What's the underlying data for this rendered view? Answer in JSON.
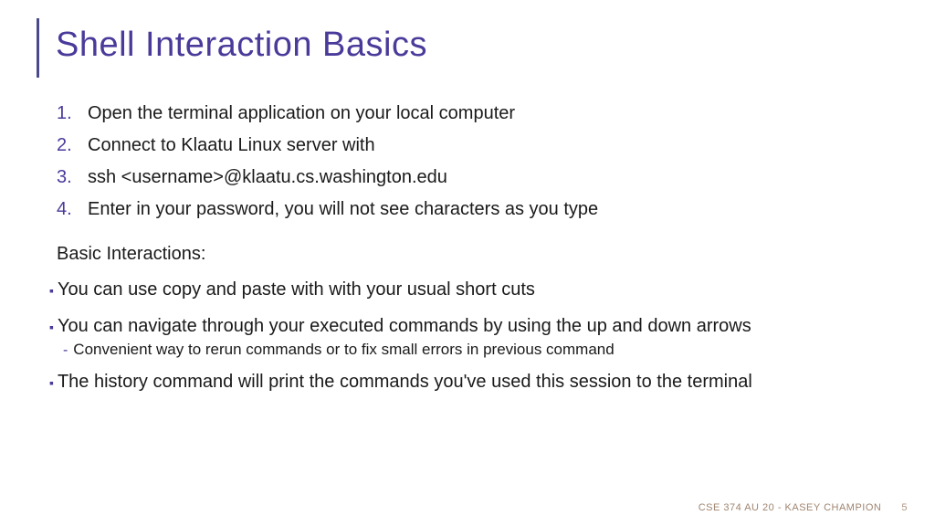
{
  "title": "Shell Interaction Basics",
  "numbered": [
    "Open the terminal application on your local computer",
    "Connect to Klaatu Linux server with",
    "ssh <username>@klaatu.cs.washington.edu",
    "Enter in your password, you will not see characters as you type"
  ],
  "section_label": "Basic Interactions:",
  "bullets": [
    {
      "text": "You can use copy and paste with with your usual short cuts",
      "sub": null
    },
    {
      "text": "You can navigate through your executed commands by using the up and down arrows",
      "sub": "Convenient way to rerun commands or to fix small errors in previous command"
    },
    {
      "text": "The history command will print the commands you've used this session to the terminal",
      "sub": null
    }
  ],
  "footer": {
    "label": "CSE 374 AU 20 - KASEY CHAMPION",
    "page": "5"
  }
}
